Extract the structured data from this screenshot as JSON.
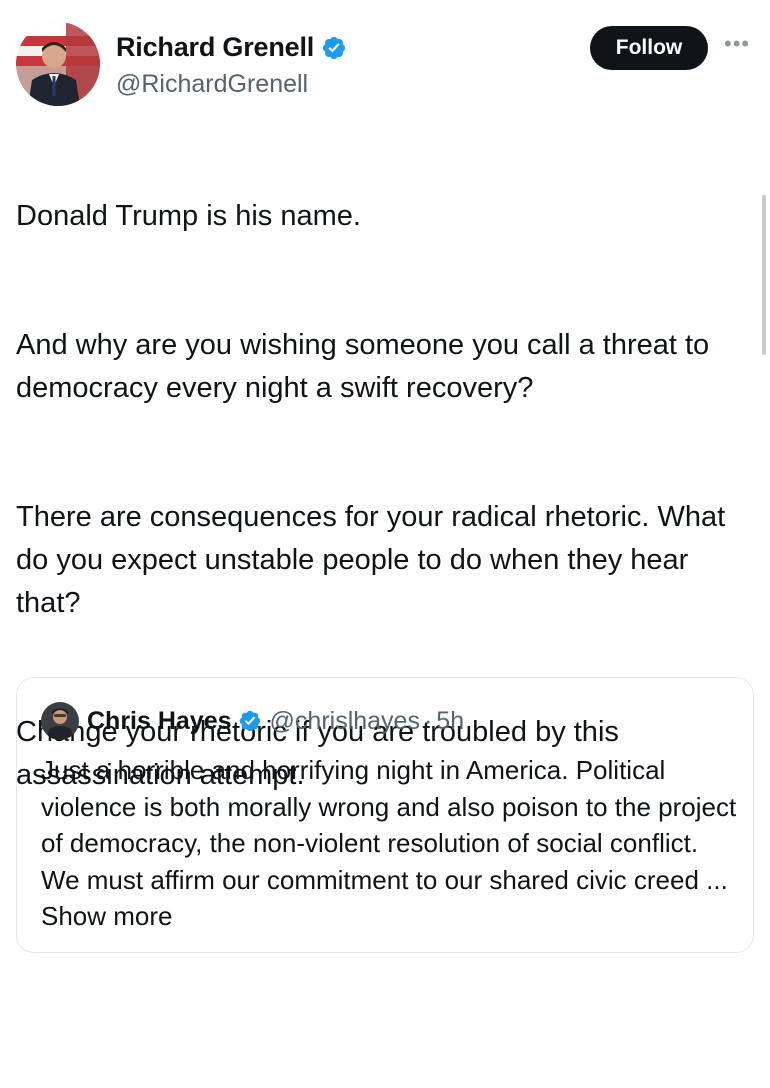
{
  "author": {
    "name": "Richard Grenell",
    "handle": "@RichardGrenell",
    "verified": true
  },
  "actions": {
    "follow_label": "Follow",
    "more_icon": "more-icon"
  },
  "tweet": {
    "paragraphs": [
      "Donald Trump is his name.",
      "And why are you wishing someone you call a threat to democracy every night a swift recovery?",
      "There are consequences for your radical rhetoric. What do you expect unstable people to do when they hear that?",
      "Change your rhetoric if you are troubled by this assassination attempt."
    ]
  },
  "quote": {
    "name": "Chris Hayes",
    "handle": "@chrislhayes",
    "separator": "·",
    "time": "5h",
    "text": "Just a horrible and horrifying night in America. Political violence is both morally wrong and also poison to the project of democracy, the non-violent resolution of social conflict. We must affirm our commitment to our shared civic creed ...",
    "show_more": "Show more"
  },
  "colors": {
    "verified_blue": "#1d9bf0",
    "follow_bg": "#0f1419",
    "text_secondary": "#536471"
  }
}
